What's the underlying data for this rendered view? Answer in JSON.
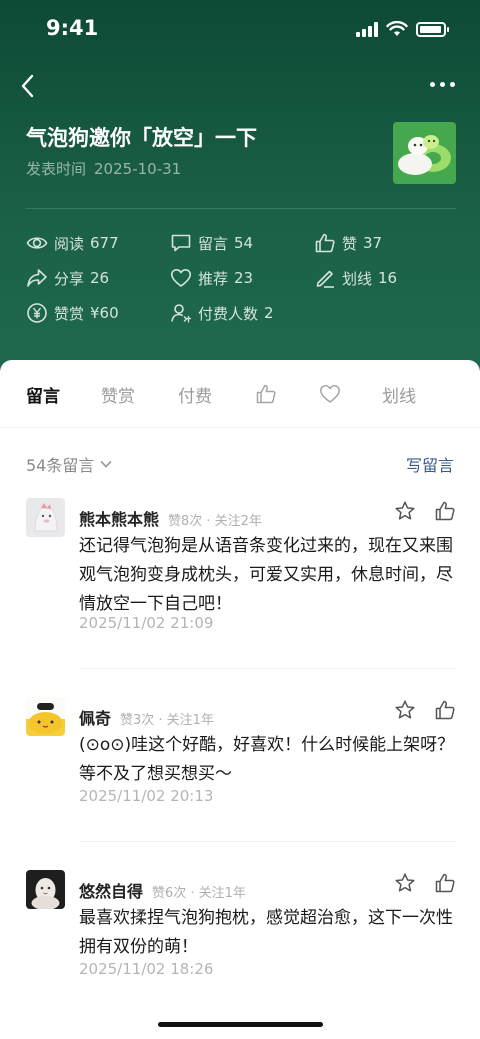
{
  "status_bar": {
    "time": "9:41"
  },
  "article": {
    "title": "气泡狗邀你「放空」一下",
    "date_label": "发表时间",
    "date": "2025-10-31"
  },
  "stats": [
    {
      "icon": "eye-icon",
      "label": "阅读",
      "value": "677"
    },
    {
      "icon": "comment-icon",
      "label": "留言",
      "value": "54"
    },
    {
      "icon": "thumbs-up-icon",
      "label": "赞",
      "value": "37"
    },
    {
      "icon": "share-icon",
      "label": "分享",
      "value": "26"
    },
    {
      "icon": "heart-icon",
      "label": "推荐",
      "value": "23"
    },
    {
      "icon": "pen-icon",
      "label": "划线",
      "value": "16"
    },
    {
      "icon": "yen-icon",
      "label": "赞赏",
      "value": "¥60"
    },
    {
      "icon": "paid-user-icon",
      "label": "付费人数",
      "value": "2"
    }
  ],
  "tabs": [
    {
      "label": "留言",
      "active": true
    },
    {
      "label": "赞赏"
    },
    {
      "label": "付费"
    },
    {
      "icon": "thumbs-up-icon"
    },
    {
      "icon": "heart-icon"
    },
    {
      "label": "划线"
    }
  ],
  "filter": {
    "label": "54条留言",
    "write_label": "写留言"
  },
  "comments": [
    {
      "name": "熊本熊本熊",
      "meta": "赞8次 · 关注2年",
      "text": "还记得气泡狗是从语音条变化过来的，现在又来围观气泡狗变身成枕头，可爱又实用，休息时间，尽情放空一下自己吧！",
      "time": "2025/11/02 21:09"
    },
    {
      "name": "佩奇",
      "meta": "赞3次 · 关注1年",
      "text": "(⊙o⊙)哇这个好酷，好喜欢！什么时候能上架呀？等不及了想买想买～",
      "time": "2025/11/02 20:13"
    },
    {
      "name": "悠然自得",
      "meta": "赞6次 · 关注1年",
      "text": "最喜欢揉捏气泡狗抱枕，感觉超治愈，这下一次性拥有双份的萌！",
      "time": "2025/11/02 18:26"
    }
  ]
}
